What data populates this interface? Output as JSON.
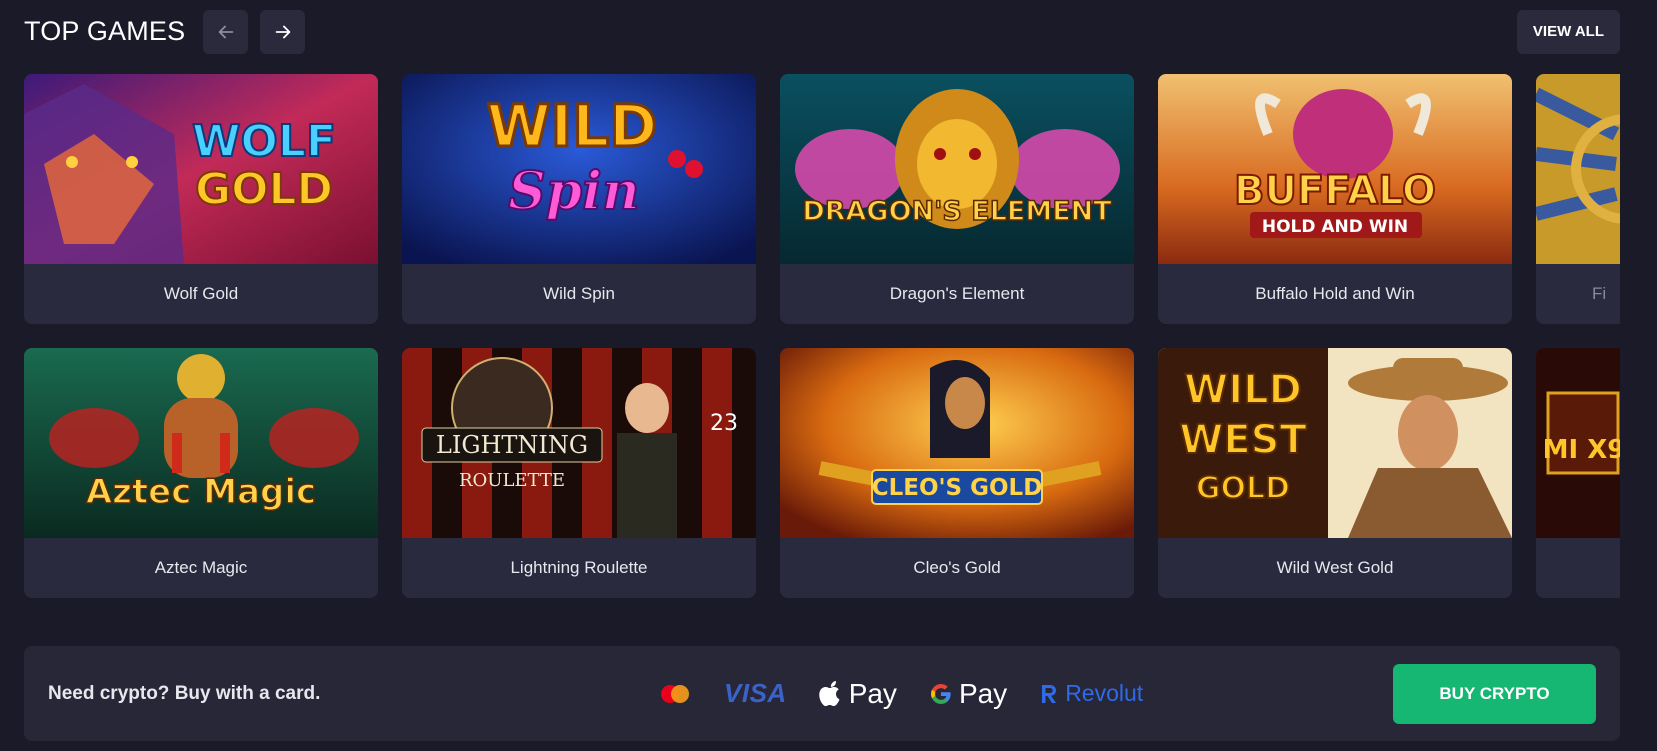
{
  "section": {
    "title": "TOP GAMES",
    "view_all_label": "VIEW ALL"
  },
  "games": [
    {
      "name": "Wolf Gold",
      "art_text": "WOLF GOLD"
    },
    {
      "name": "Wild Spin",
      "art_text": "WILD Spin"
    },
    {
      "name": "Dragon's Element",
      "art_text": "DRAGON'S ELEMENT"
    },
    {
      "name": "Buffalo Hold and Win",
      "art_text": "BUFFALO HOLD AND WIN"
    },
    {
      "name": "Fi",
      "art_text": ""
    },
    {
      "name": "Aztec Magic",
      "art_text": "Aztec Magic"
    },
    {
      "name": "Lightning Roulette",
      "art_text": "LIGHTNING ROULETTE"
    },
    {
      "name": "Cleo's Gold",
      "art_text": "CLEO'S GOLD"
    },
    {
      "name": "Wild West Gold",
      "art_text": "WILD WEST GOLD"
    },
    {
      "name": "",
      "art_text": "MI X9"
    }
  ],
  "crypto_bar": {
    "text": "Need crypto? Buy with a card.",
    "payment_methods": [
      "Mastercard",
      "VISA",
      "Pay",
      "Pay",
      "Revolut"
    ],
    "buy_label": "BUY CRYPTO"
  },
  "colors": {
    "background": "#1a1a28",
    "card": "#2a2a3f",
    "buy_button": "#16b773",
    "visa": "#3a62c9",
    "revolut": "#2f6ae8"
  }
}
